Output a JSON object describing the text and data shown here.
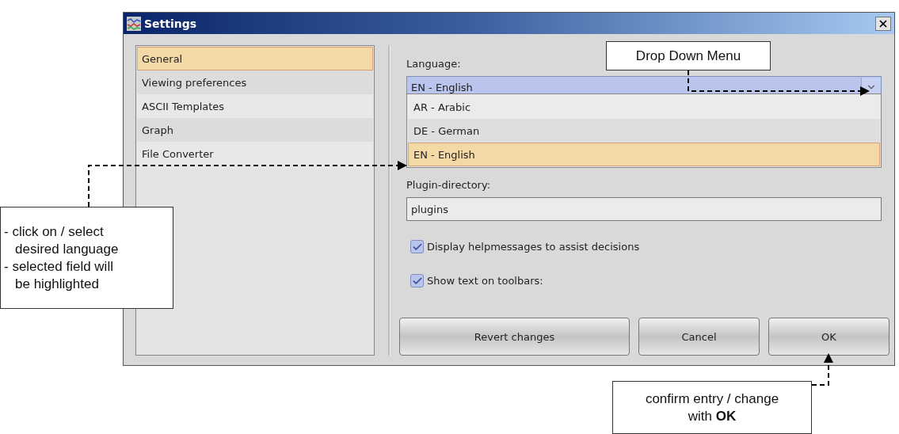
{
  "window": {
    "title": "Settings"
  },
  "sidebar": {
    "items": [
      {
        "label": "General",
        "selected": true
      },
      {
        "label": "Viewing preferences",
        "selected": false
      },
      {
        "label": "ASCII Templates",
        "selected": false
      },
      {
        "label": "Graph",
        "selected": false
      },
      {
        "label": "File Converter",
        "selected": false
      }
    ]
  },
  "language": {
    "label": "Language:",
    "value": "EN - English",
    "expanded": true,
    "options": [
      {
        "label": "AR - Arabic",
        "selected": false
      },
      {
        "label": "DE - German",
        "selected": false
      },
      {
        "label": "EN - English",
        "selected": true
      }
    ]
  },
  "plugin_directory": {
    "label": "Plugin-directory:",
    "value": "plugins"
  },
  "checkboxes": [
    {
      "label": "Display helpmessages to assist decisions",
      "checked": true
    },
    {
      "label": "Show text on toolbars:",
      "checked": true
    }
  ],
  "buttons": [
    "Revert changes",
    "Cancel",
    "OK"
  ],
  "annotations": [
    {
      "kind": "top",
      "lines": [
        {
          "text": "Drop Down Menu",
          "indent": false
        }
      ]
    },
    {
      "kind": "left",
      "lines": [
        {
          "text": "- click on / select",
          "indent": false
        },
        {
          "text": "desired language",
          "indent": true
        },
        {
          "text": "- selected field will",
          "indent": false
        },
        {
          "text": "be highlighted",
          "indent": true
        }
      ]
    },
    {
      "kind": "bottom",
      "lines": [
        {
          "text": "confirm entry / change with **OK**",
          "indent": false
        }
      ]
    }
  ]
}
